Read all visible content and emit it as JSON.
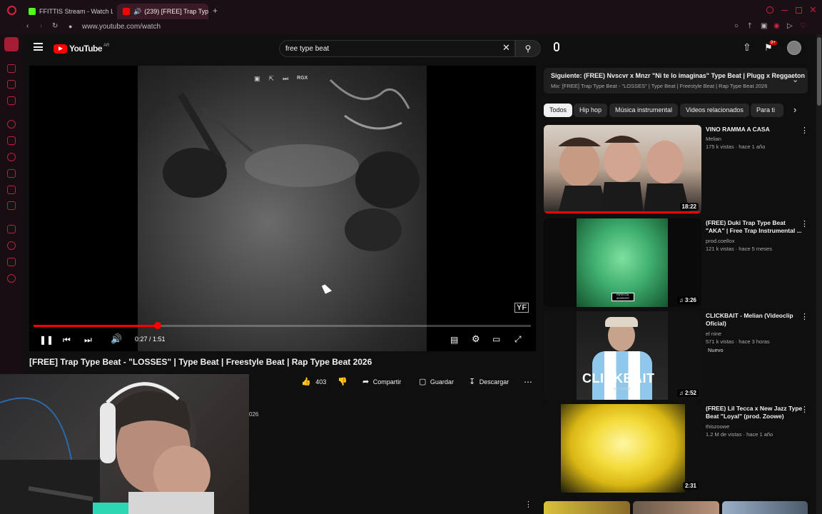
{
  "browser": {
    "tabs": [
      {
        "label": "FFITTIS Stream - Watch Li",
        "icon_color": "#53fc18"
      },
      {
        "label": "(239) [FREE] Trap Type",
        "icon_color": "#ff0000"
      }
    ],
    "url": "www.youtube.com/watch"
  },
  "youtube": {
    "logo_text": "YouTube",
    "logo_region": "AR",
    "search": {
      "value": "free type beat"
    },
    "notification_count": "9+"
  },
  "player": {
    "time": "0:27 / 1:51",
    "progress_fraction": 0.25,
    "overlay_buttons": [
      "RGX"
    ],
    "watermark": "YF"
  },
  "video": {
    "title": "[FREE] Trap Type Beat - \"LOSSES\" | Type Beat | Freestyle Beat | Rap Type Beat 2026",
    "likes": "403",
    "share": "Compartir",
    "save": "Guardar",
    "download": "Descargar",
    "description_fragment": "026"
  },
  "up_next": {
    "title": "Siguiente: (FREE) Nvscvr x Mnzr \"Ni te lo imaginas\" Type Beat | Plugg x Reggaeton",
    "subtitle": "Mix: [FREE] Trap Type Beat - \"LOSSES\" | Type Beat | Freestyle Beat | Rap Type Beat 2026"
  },
  "chips": [
    "Todos",
    "Hip hop",
    "Música instrumental",
    "Videos relacionados",
    "Para ti"
  ],
  "recommendations": [
    {
      "title": "VINO RAMMA A CASA",
      "channel": "Melian",
      "stats": "175 k vistas · hace 1 año",
      "duration": "18:22",
      "badge": ""
    },
    {
      "title": "(FREE) Duki Trap Type Beat \"AKA\" | Free Trap Instrumental ...",
      "channel": "prod.coellox",
      "stats": "121 k vistas · hace 5 meses",
      "duration": "3:26",
      "badge": ""
    },
    {
      "title": "CLICKBAIT - Melian (Videoclip Oficial)",
      "channel": "el nine",
      "stats": "571 k vistas · hace 3 horas",
      "duration": "2:52",
      "badge": "Nuevo"
    },
    {
      "title": "(FREE) Lil Tecca x New Jazz Type Beat \"Loyal\" (prod. Zoowe)",
      "channel": "thiszoowe",
      "stats": "1.2 M de vistas · hace 1 año",
      "duration": "2:31",
      "badge": ""
    }
  ],
  "thumb_texts": {
    "clickbait": "CLICKBAIT",
    "clickbait_sub": "por Melian",
    "parental": "PARENTAL ADVISORY"
  },
  "colors": {
    "accent": "#ff0000",
    "background": "#0f0f0f",
    "opera": "#b3243f"
  }
}
